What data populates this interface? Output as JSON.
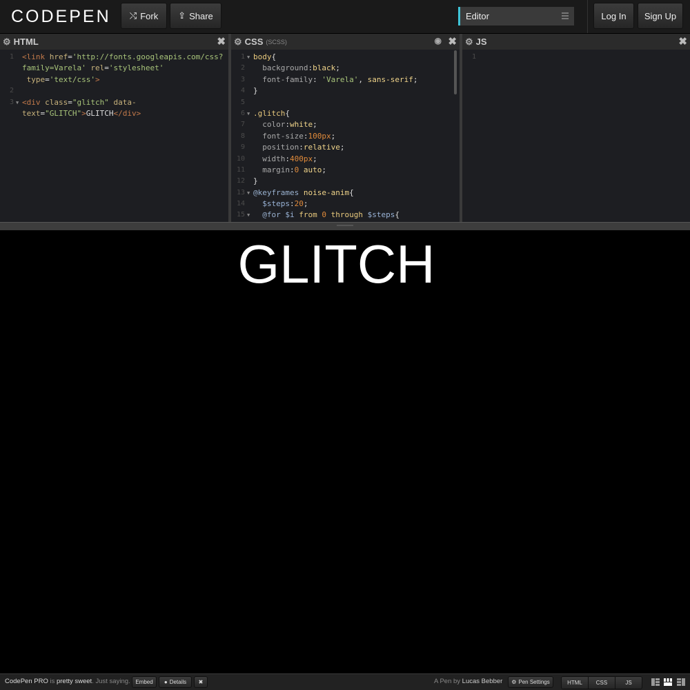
{
  "header": {
    "logo_text": "CODEPEN",
    "fork_label": "Fork",
    "share_label": "Share",
    "view_select_value": "Editor",
    "login_label": "Log In",
    "signup_label": "Sign Up",
    "accent_color": "#3fc4d8"
  },
  "panes": {
    "html": {
      "title": "HTML"
    },
    "css": {
      "title": "CSS",
      "subtitle": "(SCSS)"
    },
    "js": {
      "title": "JS"
    }
  },
  "html_code": [
    {
      "n": "1",
      "fold": false,
      "parts": [
        [
          "t-tag",
          "<"
        ],
        [
          "t-tag",
          "link "
        ],
        [
          "t-attr",
          "href"
        ],
        [
          "t-txt",
          "="
        ],
        [
          "t-str",
          "'http://fonts.googleapis.com/css?"
        ]
      ]
    },
    {
      "n": "",
      "fold": false,
      "parts": [
        [
          "t-str",
          "family=Varela'"
        ],
        [
          "t-txt",
          " "
        ],
        [
          "t-attr",
          "rel"
        ],
        [
          "t-txt",
          "="
        ],
        [
          "t-str",
          "'stylesheet'"
        ]
      ]
    },
    {
      "n": "",
      "fold": false,
      "parts": [
        [
          "t-txt",
          " "
        ],
        [
          "t-attr",
          "type"
        ],
        [
          "t-txt",
          "="
        ],
        [
          "t-str",
          "'text/css'"
        ],
        [
          "t-tag",
          ">"
        ]
      ]
    },
    {
      "n": "2",
      "fold": false,
      "parts": []
    },
    {
      "n": "3",
      "fold": true,
      "parts": [
        [
          "t-tag",
          "<div "
        ],
        [
          "t-attr",
          "class"
        ],
        [
          "t-txt",
          "="
        ],
        [
          "t-str",
          "\"glitch\""
        ],
        [
          "t-txt",
          " "
        ],
        [
          "t-attr",
          "data-"
        ]
      ]
    },
    {
      "n": "",
      "fold": false,
      "parts": [
        [
          "t-attr",
          "text"
        ],
        [
          "t-txt",
          "="
        ],
        [
          "t-str",
          "\"GLITCH\""
        ],
        [
          "t-tag",
          ">"
        ],
        [
          "t-txt",
          "GLITCH"
        ],
        [
          "t-tag",
          "</div>"
        ]
      ]
    }
  ],
  "css_code": [
    {
      "n": "1",
      "fold": true,
      "parts": [
        [
          "t-sel",
          "body"
        ],
        [
          "t-txt",
          "{"
        ]
      ]
    },
    {
      "n": "2",
      "fold": false,
      "parts": [
        [
          "t-txt",
          "  "
        ],
        [
          "t-prop",
          "background"
        ],
        [
          "t-txt",
          ":"
        ],
        [
          "t-val",
          "black"
        ],
        [
          "t-txt",
          ";"
        ]
      ]
    },
    {
      "n": "3",
      "fold": false,
      "parts": [
        [
          "t-txt",
          "  "
        ],
        [
          "t-prop",
          "font-family"
        ],
        [
          "t-txt",
          ": "
        ],
        [
          "t-str",
          "'Varela'"
        ],
        [
          "t-txt",
          ", "
        ],
        [
          "t-val",
          "sans-serif"
        ],
        [
          "t-txt",
          ";"
        ]
      ]
    },
    {
      "n": "4",
      "fold": false,
      "parts": [
        [
          "t-txt",
          "}"
        ]
      ]
    },
    {
      "n": "5",
      "fold": false,
      "parts": []
    },
    {
      "n": "6",
      "fold": true,
      "parts": [
        [
          "t-sel",
          ".glitch"
        ],
        [
          "t-txt",
          "{"
        ]
      ]
    },
    {
      "n": "7",
      "fold": false,
      "parts": [
        [
          "t-txt",
          "  "
        ],
        [
          "t-prop",
          "color"
        ],
        [
          "t-txt",
          ":"
        ],
        [
          "t-val",
          "white"
        ],
        [
          "t-txt",
          ";"
        ]
      ]
    },
    {
      "n": "8",
      "fold": false,
      "parts": [
        [
          "t-txt",
          "  "
        ],
        [
          "t-prop",
          "font-size"
        ],
        [
          "t-txt",
          ":"
        ],
        [
          "t-num",
          "100px"
        ],
        [
          "t-txt",
          ";"
        ]
      ]
    },
    {
      "n": "9",
      "fold": false,
      "parts": [
        [
          "t-txt",
          "  "
        ],
        [
          "t-prop",
          "position"
        ],
        [
          "t-txt",
          ":"
        ],
        [
          "t-val",
          "relative"
        ],
        [
          "t-txt",
          ";"
        ]
      ]
    },
    {
      "n": "10",
      "fold": false,
      "parts": [
        [
          "t-txt",
          "  "
        ],
        [
          "t-prop",
          "width"
        ],
        [
          "t-txt",
          ":"
        ],
        [
          "t-num",
          "400px"
        ],
        [
          "t-txt",
          ";"
        ]
      ]
    },
    {
      "n": "11",
      "fold": false,
      "parts": [
        [
          "t-txt",
          "  "
        ],
        [
          "t-prop",
          "margin"
        ],
        [
          "t-txt",
          ":"
        ],
        [
          "t-num",
          "0"
        ],
        [
          "t-txt",
          " "
        ],
        [
          "t-val",
          "auto"
        ],
        [
          "t-txt",
          ";"
        ]
      ]
    },
    {
      "n": "12",
      "fold": false,
      "parts": [
        [
          "t-txt",
          "}"
        ]
      ]
    },
    {
      "n": "13",
      "fold": true,
      "parts": [
        [
          "t-at",
          "@keyframes"
        ],
        [
          "t-txt",
          " "
        ],
        [
          "t-val",
          "noise-anim"
        ],
        [
          "t-txt",
          "{"
        ]
      ]
    },
    {
      "n": "14",
      "fold": false,
      "parts": [
        [
          "t-txt",
          "  "
        ],
        [
          "t-var",
          "$steps"
        ],
        [
          "t-txt",
          ":"
        ],
        [
          "t-num",
          "20"
        ],
        [
          "t-txt",
          ";"
        ]
      ]
    },
    {
      "n": "15",
      "fold": true,
      "parts": [
        [
          "t-txt",
          "  "
        ],
        [
          "t-at",
          "@for"
        ],
        [
          "t-txt",
          " "
        ],
        [
          "t-var",
          "$i"
        ],
        [
          "t-txt",
          " "
        ],
        [
          "t-kw",
          "from"
        ],
        [
          "t-txt",
          " "
        ],
        [
          "t-num",
          "0"
        ],
        [
          "t-txt",
          " "
        ],
        [
          "t-kw",
          "through"
        ],
        [
          "t-txt",
          " "
        ],
        [
          "t-var",
          "$steps"
        ],
        [
          "t-txt",
          "{"
        ]
      ]
    }
  ],
  "js_code": [
    {
      "n": "1",
      "fold": false,
      "parts": []
    }
  ],
  "preview": {
    "text": "GLITCH"
  },
  "footer": {
    "promo_a": "CodePen PRO",
    "promo_b": " is ",
    "promo_c": "pretty sweet",
    "promo_d": ". Just saying.",
    "embed_label": "Embed",
    "details_label": "Details",
    "close_label": "✖",
    "author_prefix": "A Pen by ",
    "author_name": "Lucas Bebber",
    "settings_label": "Pen Settings",
    "tab_html": "HTML",
    "tab_css": "CSS",
    "tab_js": "JS"
  }
}
